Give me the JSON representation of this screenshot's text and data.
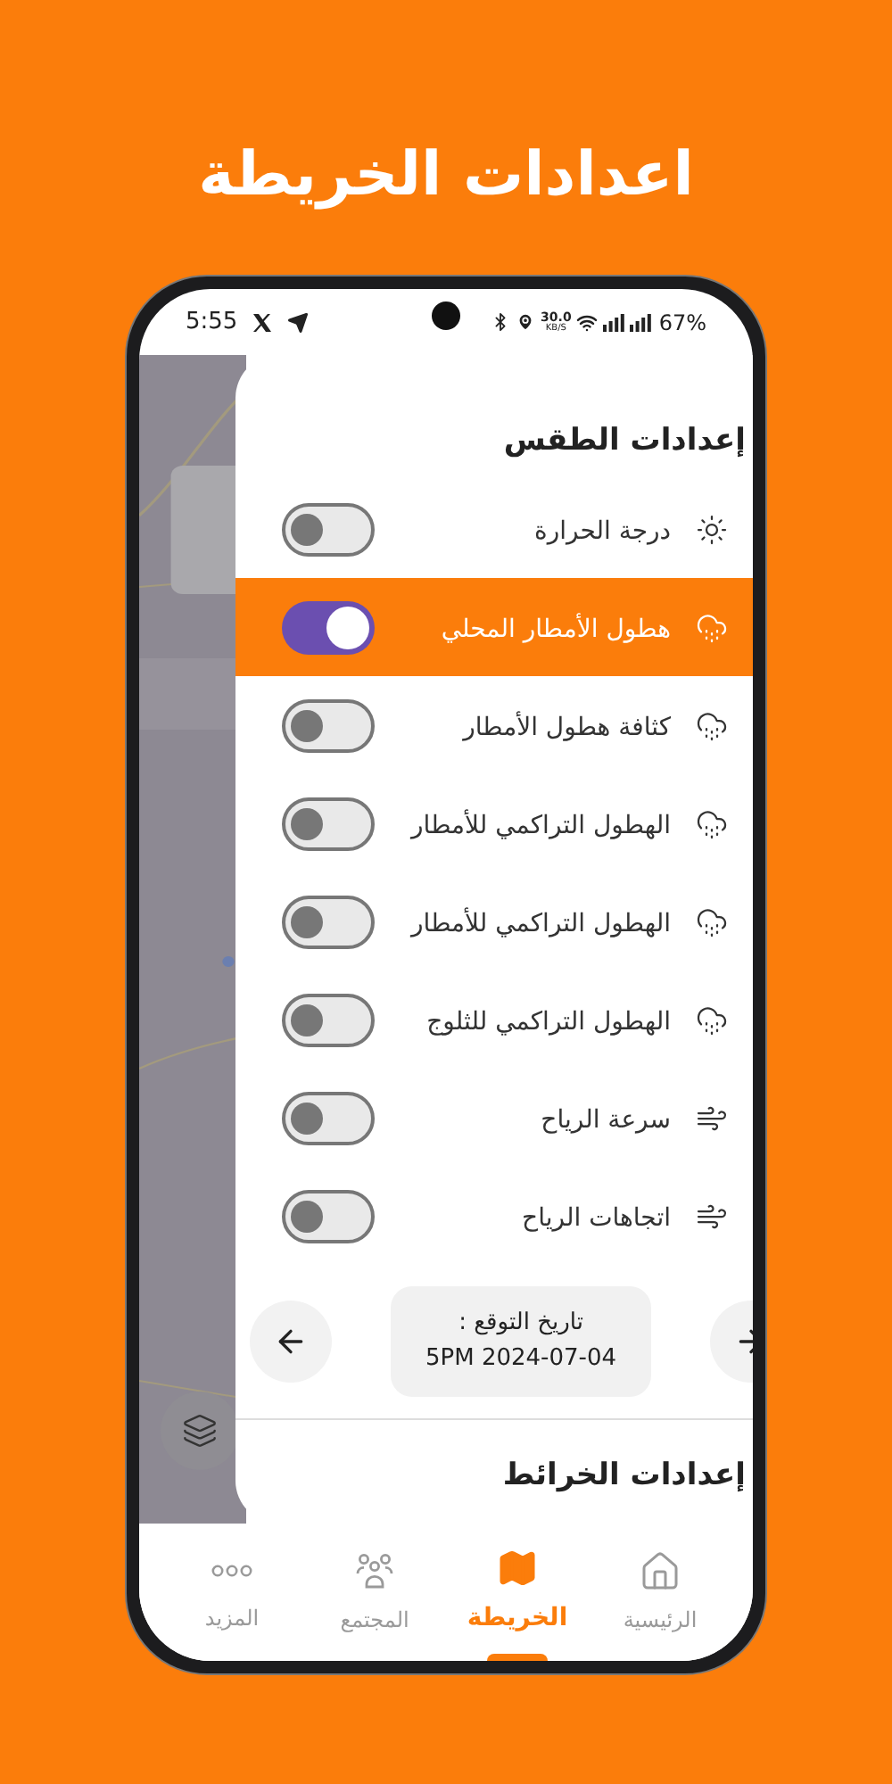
{
  "page_title": "اعدادات الخريطة",
  "status_bar": {
    "time": "5:55",
    "speed": "30.0",
    "speed_unit": "KB/S",
    "battery": "67%"
  },
  "weather_settings": {
    "title": "إعدادات الطقس",
    "items": [
      {
        "label": "درجة الحرارة",
        "kind": "temperature",
        "on": false,
        "selected": false
      },
      {
        "label": "هطول الأمطار المحلي",
        "kind": "rain",
        "on": true,
        "selected": true
      },
      {
        "label": "كثافة هطول الأمطار",
        "kind": "rain",
        "on": false,
        "selected": false
      },
      {
        "label": "الهطول التراكمي للأمطار",
        "kind": "rain",
        "on": false,
        "selected": false
      },
      {
        "label": "الهطول التراكمي للأمطار",
        "kind": "rain",
        "on": false,
        "selected": false
      },
      {
        "label": "الهطول التراكمي للثلوج",
        "kind": "rain",
        "on": false,
        "selected": false
      },
      {
        "label": "سرعة الرياح",
        "kind": "wind",
        "on": false,
        "selected": false
      },
      {
        "label": "اتجاهات الرياح",
        "kind": "wind",
        "on": false,
        "selected": false
      }
    ]
  },
  "forecast": {
    "label": "تاريخ التوقع :",
    "date": "5PM 2024-07-04"
  },
  "map_settings": {
    "title": "إعدادات الخرائط"
  },
  "bottom_nav": [
    {
      "label": "الرئيسية",
      "kind": "home",
      "selected": false
    },
    {
      "label": "الخريطة",
      "kind": "map",
      "selected": true
    },
    {
      "label": "المجتمع",
      "kind": "community",
      "selected": false
    },
    {
      "label": "المزيد",
      "kind": "more",
      "selected": false
    }
  ]
}
